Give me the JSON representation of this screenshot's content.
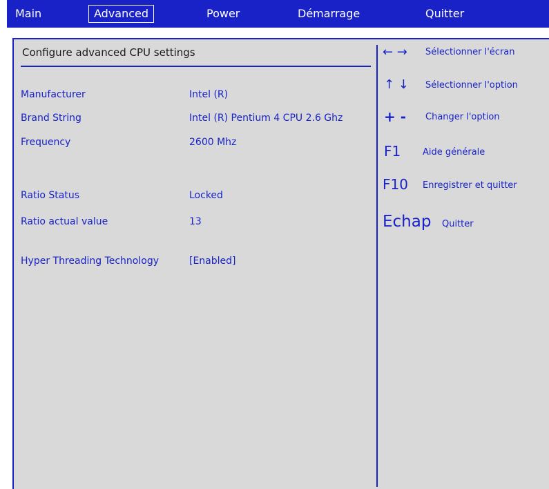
{
  "menu": {
    "items": [
      {
        "label": "Main",
        "active": false
      },
      {
        "label": "Advanced",
        "active": true
      },
      {
        "label": "Power",
        "active": false
      },
      {
        "label": "Démarrage",
        "active": false
      },
      {
        "label": "Quitter",
        "active": false
      }
    ]
  },
  "panel": {
    "title": "Configure advanced CPU settings",
    "rows": [
      {
        "label": "Manufacturer",
        "value": "Intel (R)"
      },
      {
        "label": "Brand String",
        "value": "Intel (R) Pentium 4 CPU 2.6 Ghz"
      },
      {
        "label": "Frequency",
        "value": "2600 Mhz"
      },
      {
        "label": "Ratio Status",
        "value": "Locked"
      },
      {
        "label": "Ratio actual value",
        "value": "13"
      },
      {
        "label": "Hyper Threading Technology",
        "value": "[Enabled]"
      }
    ]
  },
  "help": {
    "items": [
      {
        "key": "← →",
        "desc": "Sélectionner l'écran"
      },
      {
        "key": "↑ ↓",
        "desc": "Sélectionner l'option"
      },
      {
        "key": "+ -",
        "desc": "Changer l'option"
      },
      {
        "key": "F1",
        "desc": "Aide générale"
      },
      {
        "key": "F10",
        "desc": "Enregistrer et quitter"
      },
      {
        "key": "Echap",
        "desc": "Quitter"
      }
    ]
  },
  "colors": {
    "accent": "#1822c7",
    "panel_bg": "#d9d9d9",
    "menu_text": "#ffffff"
  }
}
